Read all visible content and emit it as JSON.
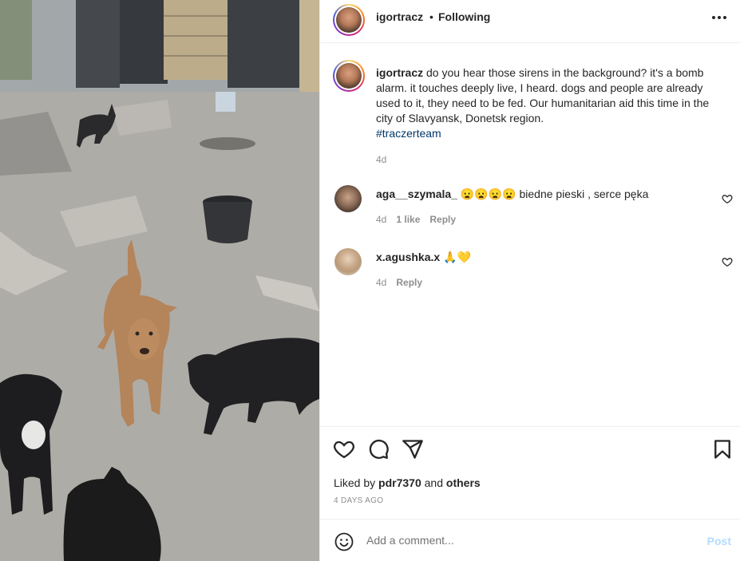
{
  "post": {
    "username": "igortracz",
    "separator": "•",
    "follow_status": "Following",
    "more_icon": "more-horizontal-icon"
  },
  "caption": {
    "username": "igortracz",
    "text": "do you hear those sirens in the background? it's a bomb alarm. it touches deeply live, I heard. dogs and people are already used to it, they need to be fed. Our humanitarian aid this time in the city of Slavyansk, Donetsk region.",
    "hashtag": "#traczerteam",
    "time": "4d"
  },
  "comments": [
    {
      "username": "aga__szymala_",
      "emojis": "😦😦😦😦",
      "text": "biedne pieski , serce pęka",
      "time": "4d",
      "likes": "1 like",
      "reply": "Reply"
    },
    {
      "username": "x.agushka.x",
      "emojis": "🙏💛",
      "text": "",
      "time": "4d",
      "reply": "Reply"
    }
  ],
  "actions": {
    "like_icon": "heart-icon",
    "comment_icon": "comment-icon",
    "share_icon": "share-icon",
    "save_icon": "bookmark-icon"
  },
  "likes": {
    "prefix": "Liked by",
    "user": "pdr7370",
    "conjunction": "and",
    "others": "others"
  },
  "date": "4 DAYS AGO",
  "add_comment": {
    "placeholder": "Add a comment...",
    "post_label": "Post"
  },
  "colors": {
    "link": "#00376b",
    "muted": "#8e8e8e",
    "post_button_disabled": "#b3dbff"
  }
}
